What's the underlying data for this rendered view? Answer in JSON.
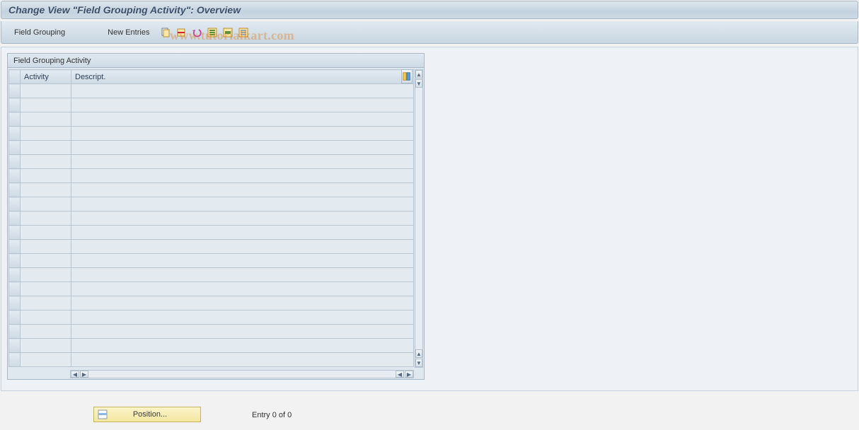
{
  "title": "Change View \"Field Grouping Activity\": Overview",
  "toolbar": {
    "menu_field_grouping": "Field Grouping",
    "new_entries": "New Entries",
    "icons": {
      "copy": "copy-icon",
      "delete": "delete-icon",
      "undo": "undo-icon",
      "select_all": "select-all-icon",
      "select_block": "select-block-icon",
      "deselect_all": "deselect-all-icon"
    }
  },
  "watermark": "www.tutorialkart.com",
  "groupbox": {
    "title": "Field Grouping Activity"
  },
  "table": {
    "columns": {
      "activity": "Activity",
      "description": "Descript."
    },
    "row_count": 20,
    "rows": []
  },
  "footer": {
    "position_label": "Position...",
    "entry_text": "Entry 0 of 0"
  }
}
